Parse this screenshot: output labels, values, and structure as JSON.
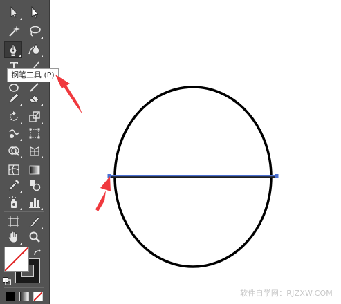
{
  "toolbar": {
    "active_tool": "pen-tool",
    "tools": [
      "selection-tool",
      "direct-selection-tool",
      "magic-wand-tool",
      "lasso-tool",
      "pen-tool",
      "curvature-tool",
      "type-tool",
      "line-segment-tool",
      "ellipse-tool",
      "eraser-tool",
      "pencil-tool",
      "eraser-tool",
      "rotate-tool",
      "scale-tool",
      "warp-tool",
      "free-transform-tool",
      "shape-builder-tool",
      "perspective-grid-tool",
      "mesh-tool",
      "gradient-tool",
      "eyedropper-tool",
      "blend-tool",
      "symbol-sprayer-tool",
      "column-graph-tool",
      "artboard-tool",
      "slice-tool",
      "hand-tool",
      "zoom-tool"
    ],
    "colors": {
      "fill": "#ffffff",
      "fill_slash": "#e02020",
      "stroke": "#000000"
    }
  },
  "tooltip": {
    "text": "钢笔工具 (P)"
  },
  "canvas": {
    "ellipse_stroke": "#000000",
    "path_color": "#4a6fd0",
    "arrow_color": "#f0393e"
  },
  "watermark": {
    "text": "软件自学网：RJZXW.COM"
  }
}
